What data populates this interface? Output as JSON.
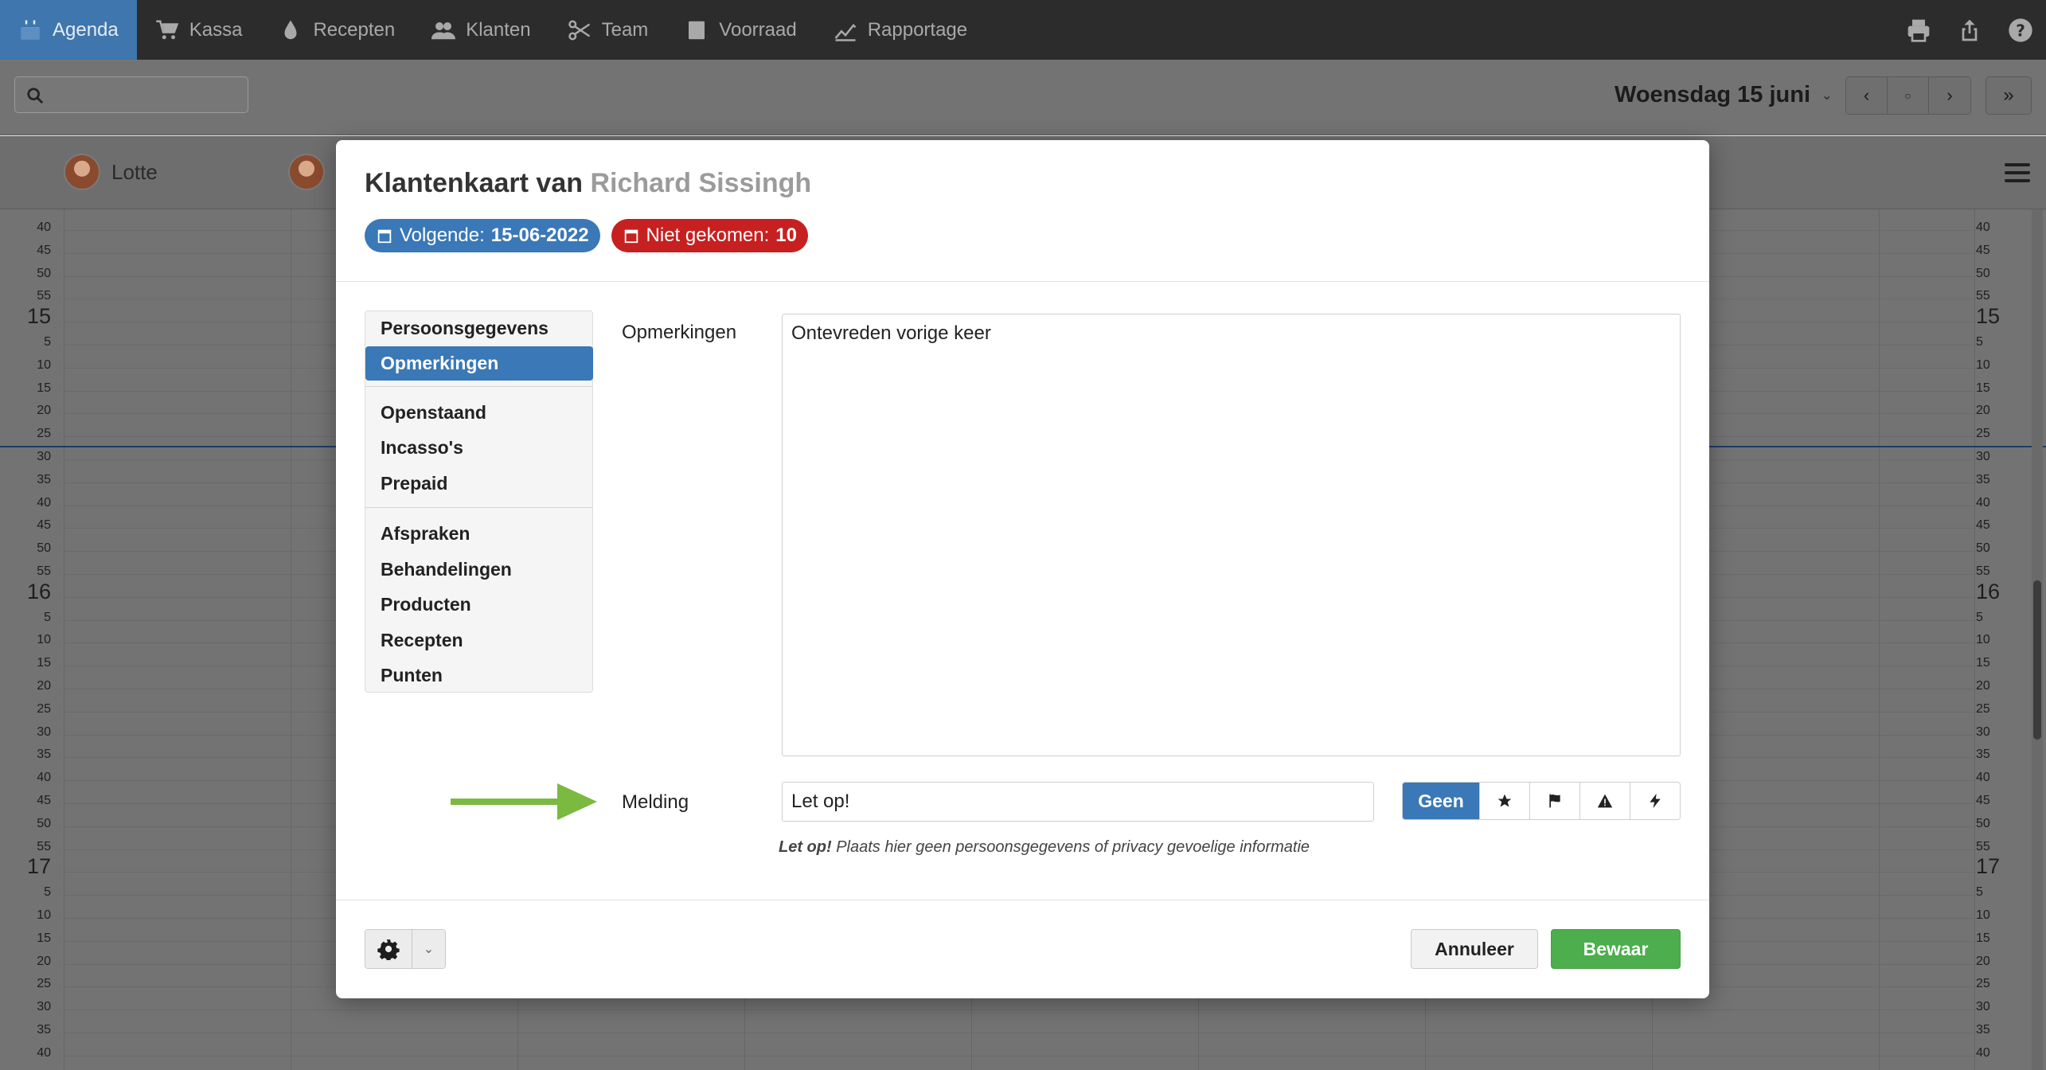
{
  "nav": {
    "items": [
      {
        "label": "Agenda",
        "icon": "calendar-icon",
        "active": true
      },
      {
        "label": "Kassa",
        "icon": "cart-icon",
        "active": false
      },
      {
        "label": "Recepten",
        "icon": "drop-icon",
        "active": false
      },
      {
        "label": "Klanten",
        "icon": "users-icon",
        "active": false
      },
      {
        "label": "Team",
        "icon": "scissors-icon",
        "active": false
      },
      {
        "label": "Voorraad",
        "icon": "box-icon",
        "active": false
      },
      {
        "label": "Rapportage",
        "icon": "chart-line-icon",
        "active": false
      }
    ],
    "right_icons": [
      "print-icon",
      "share-icon",
      "help-icon"
    ]
  },
  "toolbar": {
    "search_placeholder": "",
    "date_label": "Woensdag 15 juni"
  },
  "staff": [
    {
      "name": "Lotte"
    },
    {
      "name": ""
    }
  ],
  "calendar": {
    "left_times": [
      "40",
      "45",
      "50",
      "55",
      "15",
      "5",
      "10",
      "15",
      "20",
      "25",
      "30",
      "35",
      "40",
      "45",
      "50",
      "55",
      "16",
      "5",
      "10",
      "15",
      "20",
      "25",
      "30",
      "35",
      "40",
      "45",
      "50",
      "55",
      "17",
      "5",
      "10",
      "15",
      "20",
      "25",
      "30",
      "35",
      "40"
    ],
    "right_times": [
      "40",
      "45",
      "50",
      "55",
      "15",
      "5",
      "10",
      "15",
      "20",
      "25",
      "30",
      "35",
      "40",
      "45",
      "50",
      "55",
      "16",
      "5",
      "10",
      "15",
      "20",
      "25",
      "30",
      "35",
      "40",
      "45",
      "50",
      "55",
      "17",
      "5",
      "10",
      "15",
      "20",
      "25",
      "30",
      "35",
      "40"
    ]
  },
  "modal": {
    "title_prefix": "Klantenkaart van",
    "client_name": "Richard Sissingh",
    "badge_next_label": "Volgende:",
    "badge_next_value": "15-06-2022",
    "badge_noshow_label": "Niet gekomen:",
    "badge_noshow_value": "10",
    "menu": {
      "persoonsgegevens": "Persoonsgegevens",
      "opmerkingen": "Opmerkingen",
      "openstaand": "Openstaand",
      "incassos": "Incasso's",
      "prepaid": "Prepaid",
      "afspraken": "Afspraken",
      "behandelingen": "Behandelingen",
      "producten": "Producten",
      "recepten": "Recepten",
      "punten": "Punten"
    },
    "opmerkingen_label": "Opmerkingen",
    "opmerkingen_value": "Ontevreden vorige keer",
    "melding_label": "Melding",
    "melding_value": "Let op!",
    "tag_none": "Geen",
    "tag_icons": [
      "star-icon",
      "flag-icon",
      "warning-icon",
      "bolt-icon"
    ],
    "hint_bold": "Let op!",
    "hint_text": " Plaats hier geen persoonsgegevens of privacy gevoelige informatie",
    "cancel_label": "Annuleer",
    "save_label": "Bewaar"
  },
  "colors": {
    "accent": "#3a78b7",
    "danger": "#c72020",
    "success": "#4cae4c",
    "arrow": "#7bb940"
  }
}
